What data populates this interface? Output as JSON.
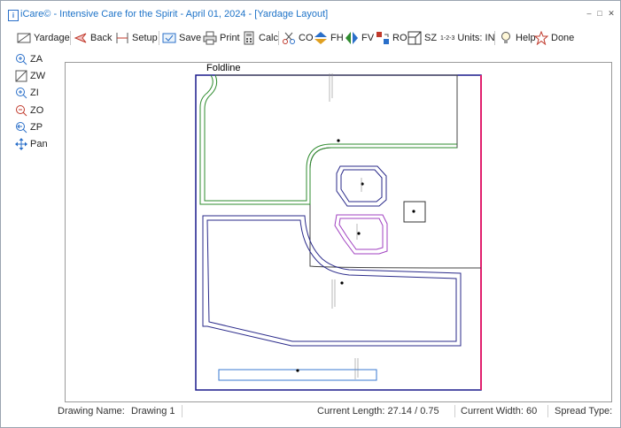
{
  "window": {
    "title": "iCare© - Intensive Care for the Spirit - April 01, 2024 - [Yardage Layout]",
    "app_icon_letter": "i",
    "controls": {
      "minimize": "–",
      "restore": "□",
      "close": "✕"
    }
  },
  "toolbar": {
    "yardage": "Yardage",
    "back": "Back",
    "setup": "Setup",
    "save": "Save",
    "print": "Print",
    "calc": "Calc",
    "co": "CO",
    "fh": "FH",
    "fv": "FV",
    "ro": "RO",
    "sz": "SZ",
    "units_icon": "1-2-3",
    "units": "Units: IN",
    "help": "Help",
    "done": "Done"
  },
  "sidebar": {
    "za": "ZA",
    "zw": "ZW",
    "zi": "ZI",
    "zo": "ZO",
    "zp": "ZP",
    "pan": "Pan"
  },
  "canvas": {
    "foldline_label": "Foldline"
  },
  "status": {
    "drawing_name_label": "Drawing Name:",
    "drawing_name": "Drawing 1",
    "current_length": "Current Length: 27.14  /  0.75",
    "current_width": "Current Width: 60",
    "spread_type": "Spread Type:"
  },
  "colors": {
    "title": "#1e73c8",
    "fabric_border": "#1a1a8c",
    "selvage": "#e0206e",
    "piece_green": "#2e8b2e",
    "piece_navy": "#2a2a8a",
    "piece_purple": "#a040c0",
    "piece_gray": "#444444",
    "piece_blue_light": "#3a7ad0"
  }
}
